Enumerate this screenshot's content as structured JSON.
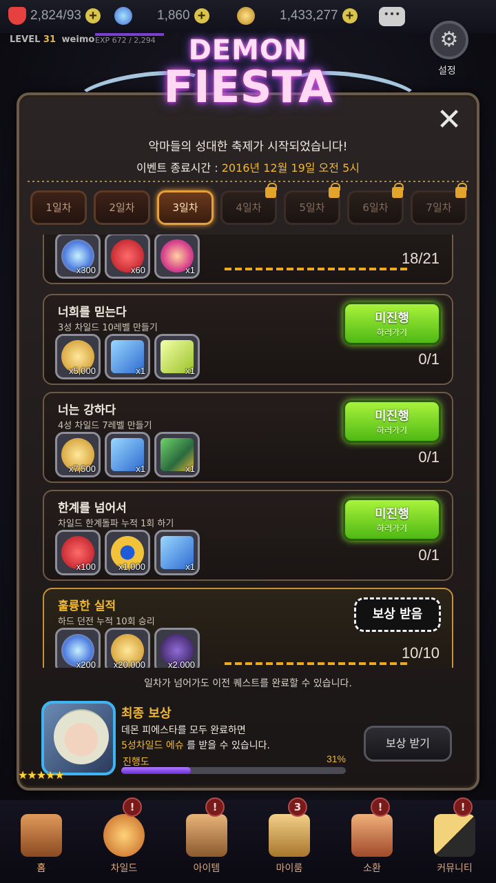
{
  "hud": {
    "hearts": "2,824/93",
    "gems": "1,860",
    "gold": "1,433,277",
    "level_label": "LEVEL",
    "level": "31",
    "username": "weimo",
    "exp": "EXP 672 / 2,294",
    "settings_label": "설정"
  },
  "logo": {
    "line1": "DEMON",
    "line2": "FIESTA"
  },
  "event": {
    "subtitle": "악마들의 성대한 축제가 시작되었습니다!",
    "end_label": "이벤트 종료시간 : ",
    "end_value": "2016년 12월 19일 오전 5시"
  },
  "tabs": [
    {
      "label": "1일차",
      "state": "normal"
    },
    {
      "label": "2일차",
      "state": "normal"
    },
    {
      "label": "3일차",
      "state": "active"
    },
    {
      "label": "4일차",
      "state": "locked"
    },
    {
      "label": "5일차",
      "state": "locked"
    },
    {
      "label": "6일차",
      "state": "locked"
    },
    {
      "label": "7일차",
      "state": "locked"
    }
  ],
  "quests": [
    {
      "title": "",
      "desc": "",
      "items": [
        {
          "qty": "x300",
          "icon": "gem-icon"
        },
        {
          "qty": "x60",
          "icon": "heart-icon"
        },
        {
          "qty": "x1",
          "icon": "ticket-icon"
        }
      ],
      "progress": "18/21",
      "button": {
        "type": "none"
      }
    },
    {
      "title": "너희를 믿는다",
      "desc": "3성 차일드 10레벨 만들기",
      "items": [
        {
          "qty": "x5,000",
          "icon": "gold-coins-icon"
        },
        {
          "qty": "x1",
          "icon": "card-icon"
        },
        {
          "qty": "x1",
          "icon": "ticket-icon"
        }
      ],
      "progress": "0/1",
      "button": {
        "type": "go",
        "label": "미진행",
        "sub": "하러가기"
      }
    },
    {
      "title": "너는 강하다",
      "desc": "4성 차일드 7레벨 만들기",
      "items": [
        {
          "qty": "x7,500",
          "icon": "gold-coins-icon"
        },
        {
          "qty": "x1",
          "icon": "card-icon"
        },
        {
          "qty": "x1",
          "icon": "book-icon"
        }
      ],
      "progress": "0/1",
      "button": {
        "type": "go",
        "label": "미진행",
        "sub": "하러가기"
      }
    },
    {
      "title": "한계를 넘어서",
      "desc": "차일드 한계돌파 누적 1회 하기",
      "items": [
        {
          "qty": "x100",
          "icon": "heart-icon"
        },
        {
          "qty": "x1,000",
          "icon": "medal-icon"
        },
        {
          "qty": "x1",
          "icon": "card-icon"
        }
      ],
      "progress": "0/1",
      "button": {
        "type": "go",
        "label": "미진행",
        "sub": "하러가기"
      }
    },
    {
      "title": "훌륭한 실적",
      "desc": "하드 던전 누적 10회 승리",
      "items": [
        {
          "qty": "x200",
          "icon": "gem-icon"
        },
        {
          "qty": "x20,000",
          "icon": "gold-coins-icon"
        },
        {
          "qty": "x2,000",
          "icon": "dark-crystal-icon"
        }
      ],
      "progress": "10/10",
      "button": {
        "type": "claim",
        "label": "보상 받음"
      }
    }
  ],
  "note": "일차가 넘어가도 이전 퀘스트를 완료할 수 있습니다.",
  "final_reward": {
    "title": "최종 보상",
    "line1": "데몬 피에스타를 모두 완료하면",
    "line2_highlight": "5성차일드 에슈",
    "line2_rest": " 를 받을 수 있습니다.",
    "progress_label": "진행도",
    "progress_pct": "31%",
    "progress_value": 0.31,
    "stars": "★★★★★",
    "button": "보상 받기"
  },
  "nav": [
    {
      "label": "홈",
      "icon": "home-icon",
      "badge": ""
    },
    {
      "label": "차일드",
      "icon": "child-icon",
      "badge": "!"
    },
    {
      "label": "아이템",
      "icon": "item-icon",
      "badge": "!"
    },
    {
      "label": "마이룸",
      "icon": "myroom-icon",
      "badge": "3"
    },
    {
      "label": "소환",
      "icon": "summon-icon",
      "badge": "!"
    },
    {
      "label": "커뮤니티",
      "icon": "community-icon",
      "badge": "!"
    }
  ],
  "colors": {
    "accent": "#f0b834",
    "go_button": "#7fdc2b",
    "panel_border": "#6b5b4a",
    "progress_fill": "#6a2bd6"
  }
}
